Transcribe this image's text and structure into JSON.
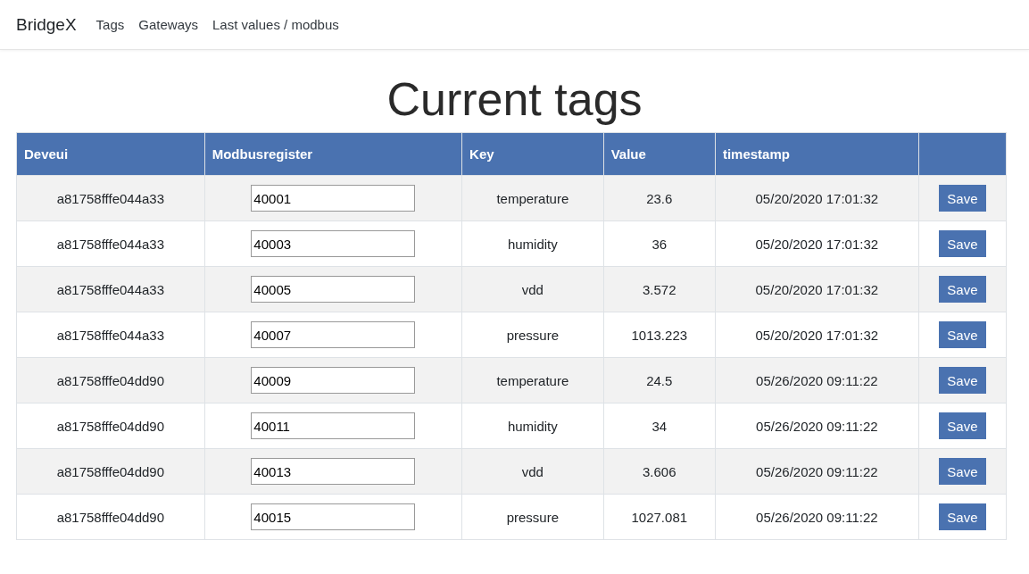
{
  "navbar": {
    "brand": "BridgeX",
    "links": [
      "Tags",
      "Gateways",
      "Last values / modbus"
    ]
  },
  "title": "Current tags",
  "table": {
    "columns": [
      "Deveui",
      "Modbusregister",
      "Key",
      "Value",
      "timestamp"
    ],
    "rows": [
      {
        "deveui": "a81758fffe044a33",
        "register": "40001",
        "key": "temperature",
        "value": "23.6",
        "timestamp": "05/20/2020 17:01:32",
        "action": "Save"
      },
      {
        "deveui": "a81758fffe044a33",
        "register": "40003",
        "key": "humidity",
        "value": "36",
        "timestamp": "05/20/2020 17:01:32",
        "action": "Save"
      },
      {
        "deveui": "a81758fffe044a33",
        "register": "40005",
        "key": "vdd",
        "value": "3.572",
        "timestamp": "05/20/2020 17:01:32",
        "action": "Save"
      },
      {
        "deveui": "a81758fffe044a33",
        "register": "40007",
        "key": "pressure",
        "value": "1013.223",
        "timestamp": "05/20/2020 17:01:32",
        "action": "Save"
      },
      {
        "deveui": "a81758fffe04dd90",
        "register": "40009",
        "key": "temperature",
        "value": "24.5",
        "timestamp": "05/26/2020 09:11:22",
        "action": "Save"
      },
      {
        "deveui": "a81758fffe04dd90",
        "register": "40011",
        "key": "humidity",
        "value": "34",
        "timestamp": "05/26/2020 09:11:22",
        "action": "Save"
      },
      {
        "deveui": "a81758fffe04dd90",
        "register": "40013",
        "key": "vdd",
        "value": "3.606",
        "timestamp": "05/26/2020 09:11:22",
        "action": "Save"
      },
      {
        "deveui": "a81758fffe04dd90",
        "register": "40015",
        "key": "pressure",
        "value": "1027.081",
        "timestamp": "05/26/2020 09:11:22",
        "action": "Save"
      }
    ]
  }
}
